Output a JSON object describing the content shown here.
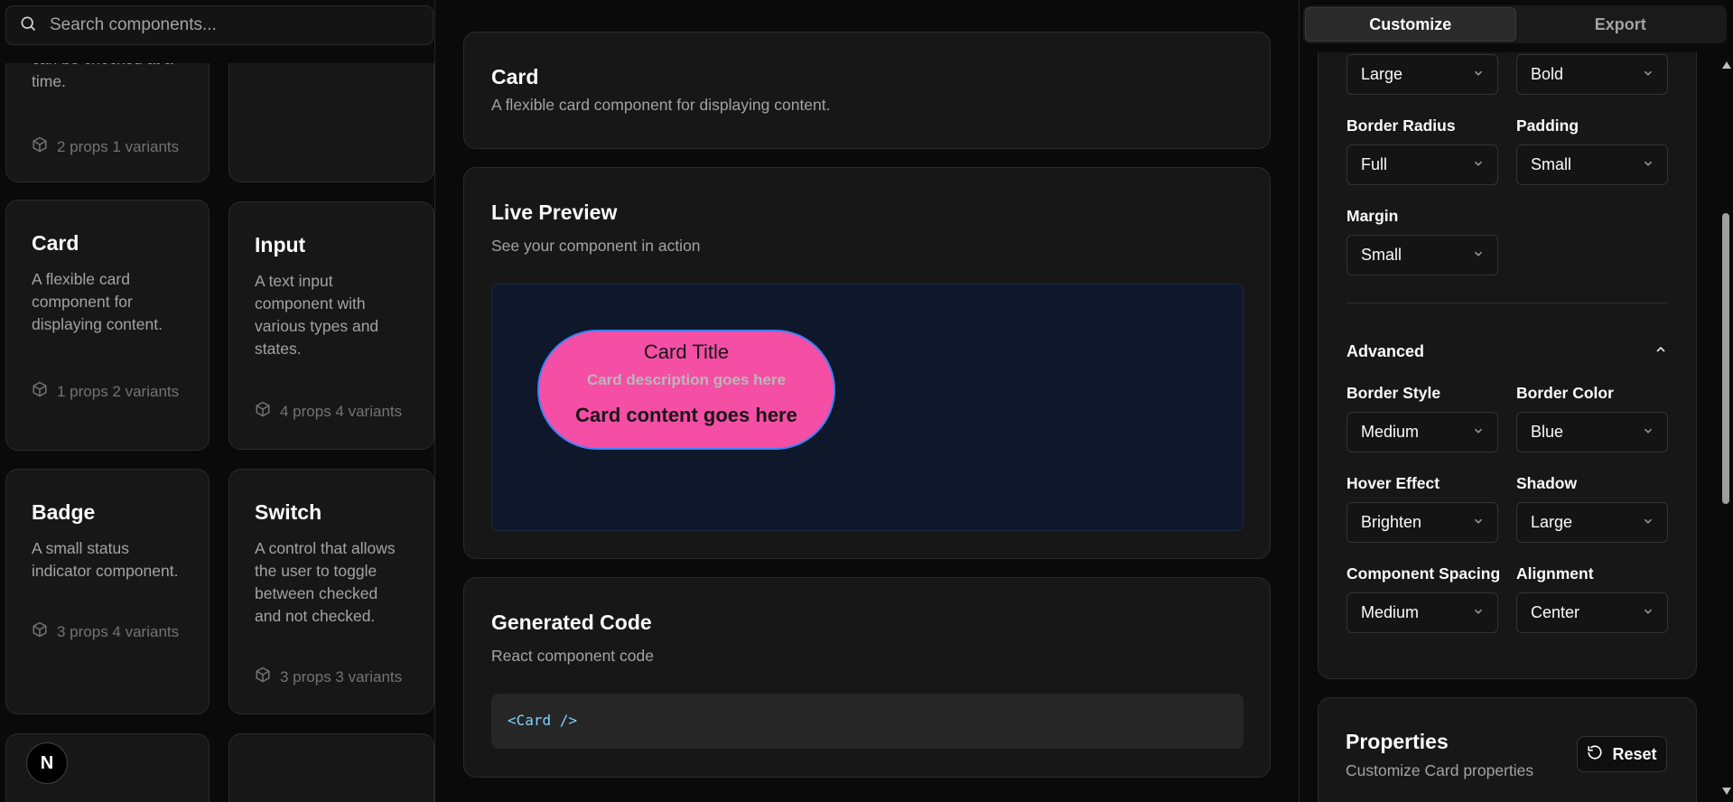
{
  "search": {
    "placeholder": "Search components..."
  },
  "tiles": {
    "partial_left": {
      "desc_tail1": "can be checked at a",
      "desc_tail2": "time.",
      "meta": "2 props 1 variants"
    },
    "card": {
      "title": "Card",
      "desc": "A flexible card component for displaying content.",
      "meta": "1 props 2 variants"
    },
    "input": {
      "title": "Input",
      "desc": "A text input component with various types and states.",
      "meta": "4 props 4 variants"
    },
    "badge": {
      "title": "Badge",
      "desc": "A small status indicator component.",
      "meta": "3 props 4 variants"
    },
    "switch": {
      "title": "Switch",
      "desc": "A control that allows the user to toggle between checked and not checked.",
      "meta": "3 props 3 variants"
    }
  },
  "logo": {
    "letter": "N"
  },
  "header": {
    "title": "Card",
    "description": "A flexible card component for displaying content."
  },
  "preview": {
    "title": "Live Preview",
    "subtitle": "See your component in action",
    "card_title": "Card Title",
    "card_description": "Card description goes here",
    "card_content": "Card content goes here"
  },
  "code": {
    "title": "Generated Code",
    "subtitle": "React component code",
    "snippet": "<Card />"
  },
  "tabs": [
    {
      "label": "Customize"
    },
    {
      "label": "Export"
    }
  ],
  "settings": {
    "top_left": {
      "value": "Large"
    },
    "top_right": {
      "value": "Bold"
    },
    "border_radius": {
      "label": "Border Radius",
      "value": "Full"
    },
    "padding": {
      "label": "Padding",
      "value": "Small"
    },
    "margin": {
      "label": "Margin",
      "value": "Small"
    },
    "advanced": {
      "label": "Advanced"
    },
    "border_style": {
      "label": "Border Style",
      "value": "Medium"
    },
    "border_color": {
      "label": "Border Color",
      "value": "Blue"
    },
    "hover_effect": {
      "label": "Hover Effect",
      "value": "Brighten"
    },
    "shadow": {
      "label": "Shadow",
      "value": "Large"
    },
    "component_spacing": {
      "label": "Component Spacing",
      "value": "Medium"
    },
    "alignment": {
      "label": "Alignment",
      "value": "Center"
    }
  },
  "properties": {
    "title": "Properties",
    "subtitle": "Customize Card properties",
    "reset_label": "Reset"
  },
  "colors": {
    "preview_card": "#f54ea5",
    "preview_border": "#3b82f6",
    "preview_bg": "#0f172a"
  }
}
